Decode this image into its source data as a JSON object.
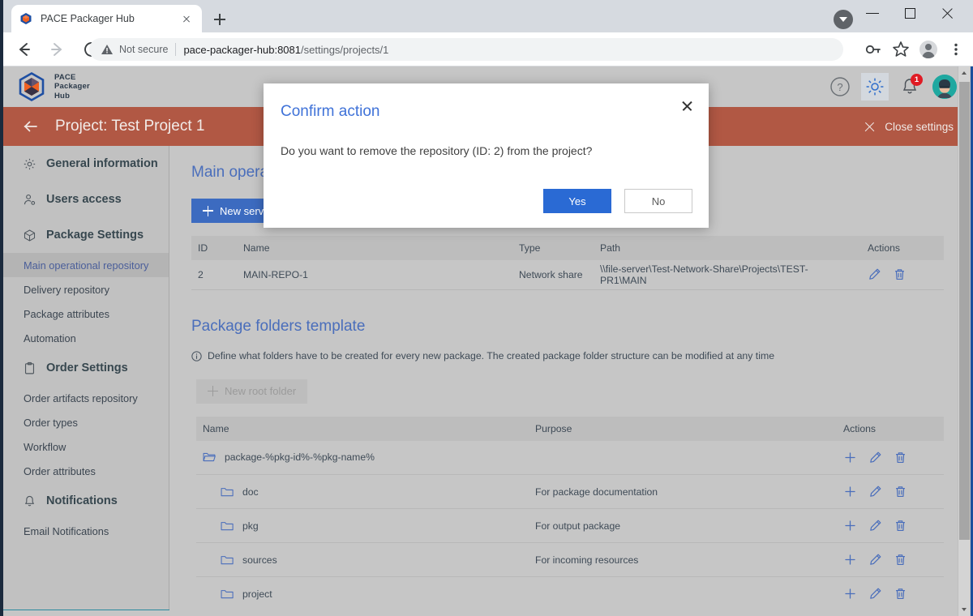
{
  "browser": {
    "tab": {
      "title": "PACE Packager Hub",
      "favicon_icon": "cube-favicon",
      "close_icon": "close-icon"
    },
    "new_tab_icon": "plus-icon",
    "window_controls": {
      "minimize_icon": "minimize-icon",
      "maximize_icon": "maximize-icon",
      "close_icon": "close-icon",
      "caret_icon": "chevron-down-icon"
    },
    "nav": {
      "back_icon": "back-arrow-icon",
      "forward_icon": "forward-arrow-icon",
      "reload_icon": "reload-icon"
    },
    "omnibox": {
      "security_icon": "warning-triangle-icon",
      "security_label": "Not secure",
      "url_host": "pace-packager-hub:8081",
      "url_path": "/settings/projects/1"
    },
    "toolbar_right": {
      "password_icon": "key-icon",
      "bookmark_icon": "star-icon",
      "profile_icon": "person-avatar-icon",
      "menu_icon": "three-dot-menu-icon"
    }
  },
  "app": {
    "brand": {
      "line1": "PACE",
      "line2": "Packager",
      "line3": "Hub",
      "logo_icon": "pace-cube-logo-icon"
    },
    "header_icons": {
      "help": "question-mark-circle-icon",
      "settings": "gear-icon",
      "notifications": "bell-icon",
      "notifications_badge": "1",
      "avatar": "user-avatar-icon"
    },
    "project_bar": {
      "back_icon": "back-arrow-icon",
      "title": "Project: Test Project 1",
      "close_settings_label": "Close settings",
      "close_settings_icon": "close-icon"
    }
  },
  "sidebar": {
    "groups": [
      {
        "label": "General information",
        "icon": "gear-icon",
        "items": []
      },
      {
        "label": "Users access",
        "icon": "user-access-icon",
        "items": []
      },
      {
        "label": "Package Settings",
        "icon": "package-cube-icon",
        "items": [
          {
            "label": "Main operational repository",
            "selected": true
          },
          {
            "label": "Delivery repository",
            "selected": false
          },
          {
            "label": "Package attributes",
            "selected": false
          },
          {
            "label": "Automation",
            "selected": false
          }
        ]
      },
      {
        "label": "Order Settings",
        "icon": "clipboard-icon",
        "items": [
          {
            "label": "Order artifacts repository",
            "selected": false
          },
          {
            "label": "Order types",
            "selected": false
          },
          {
            "label": "Workflow",
            "selected": false
          },
          {
            "label": "Order attributes",
            "selected": false
          }
        ]
      },
      {
        "label": "Notifications",
        "icon": "bell-icon",
        "items": [
          {
            "label": "Email Notifications",
            "selected": false
          }
        ]
      }
    ]
  },
  "main": {
    "section1": {
      "title": "Main operational repository",
      "new_server_button": "New server",
      "columns": [
        "ID",
        "Name",
        "Type",
        "Path",
        "Actions"
      ],
      "rows": [
        {
          "id": "2",
          "name": "MAIN-REPO-1",
          "type": "Network share",
          "path": "\\\\file-server\\Test-Network-Share\\Projects\\TEST-PR1\\MAIN",
          "edit_icon": "pencil-icon",
          "delete_icon": "trash-icon"
        }
      ]
    },
    "section2": {
      "title": "Package folders template",
      "hint_icon": "info-circle-icon",
      "hint": "Define what folders have to be created for every new package. The created package folder structure can be modified at any time",
      "new_root_folder_button": "New root folder",
      "columns": [
        "Name",
        "Purpose",
        "Actions"
      ],
      "rows": [
        {
          "name": "package-%pkg-id%-%pkg-name%",
          "purpose": "",
          "level": 0,
          "icon": "open-folder-icon",
          "add_icon": "plus-icon",
          "edit_icon": "pencil-icon",
          "delete_icon": "trash-icon"
        },
        {
          "name": "doc",
          "purpose": "For package documentation",
          "level": 1,
          "icon": "folder-icon",
          "add_icon": "plus-icon",
          "edit_icon": "pencil-icon",
          "delete_icon": "trash-icon"
        },
        {
          "name": "pkg",
          "purpose": "For output package",
          "level": 1,
          "icon": "folder-icon",
          "add_icon": "plus-icon",
          "edit_icon": "pencil-icon",
          "delete_icon": "trash-icon"
        },
        {
          "name": "sources",
          "purpose": "For incoming resources",
          "level": 1,
          "icon": "folder-icon",
          "add_icon": "plus-icon",
          "edit_icon": "pencil-icon",
          "delete_icon": "trash-icon"
        },
        {
          "name": "project",
          "purpose": "",
          "level": 1,
          "icon": "folder-icon",
          "add_icon": "plus-icon",
          "edit_icon": "pencil-icon",
          "delete_icon": "trash-icon"
        }
      ]
    }
  },
  "modal": {
    "title": "Confirm action",
    "message": "Do you want to remove the repository (ID: 2) from the project?",
    "yes_label": "Yes",
    "no_label": "No",
    "close_icon": "close-icon"
  },
  "colors": {
    "accent_blue": "#3f72d8",
    "primary_button": "#3c6bc0",
    "project_bar": "#b15844",
    "badge_red": "#e01b24",
    "app_bg": "#c6c6c6",
    "sidebar_bg": "#c1c1c1"
  }
}
